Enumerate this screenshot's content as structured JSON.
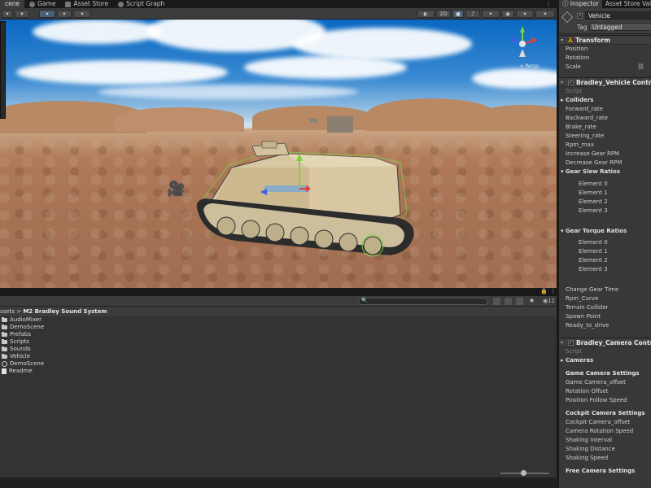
{
  "editor_tabs": [
    {
      "label": "cene",
      "active": true,
      "icon": "scene-icon"
    },
    {
      "label": "Game",
      "active": false,
      "icon": "game-icon"
    },
    {
      "label": "Asset Store",
      "active": false,
      "icon": "asset-store-icon"
    },
    {
      "label": "Script Graph",
      "active": false,
      "icon": "script-graph-icon"
    }
  ],
  "scene_toolbar": {
    "mode_2d": "2D"
  },
  "scene": {
    "gizmo_label": "< Persp"
  },
  "project": {
    "search_count": "11",
    "breadcrumb_root": "ssets",
    "breadcrumb_sep": " > ",
    "breadcrumb_current": "M2 Bradley Sound System",
    "items": [
      {
        "name": "AudioMixer",
        "type": "folder"
      },
      {
        "name": "DemoScene",
        "type": "folder"
      },
      {
        "name": "Prefabs",
        "type": "folder"
      },
      {
        "name": "Scripts",
        "type": "folder"
      },
      {
        "name": "Sounds",
        "type": "folder"
      },
      {
        "name": "Vehicle",
        "type": "folder"
      },
      {
        "name": "DemoScene",
        "type": "scene"
      },
      {
        "name": "Readme",
        "type": "document"
      }
    ]
  },
  "inspector": {
    "tabs": [
      {
        "label": "Inspector",
        "active": true
      },
      {
        "label": "Asset Store Validat",
        "active": false
      }
    ],
    "object_name": "Vehicle",
    "tag_label": "Tag",
    "tag_value": "Untagged",
    "transform": {
      "title": "Transform",
      "fields": [
        "Position",
        "Rotation",
        "Scale"
      ]
    },
    "vehicle_controller": {
      "title": "Bradley_Vehicle Controlle",
      "script_label": "Script",
      "colliders": "Colliders",
      "fields": [
        "Forward_rate",
        "Backward_rate",
        "Brake_rate",
        "Steering_rate",
        "Rpm_max",
        "Increase Gear RPM",
        "Decrease Gear RPM"
      ],
      "slew_title": "Gear Slew Ratios",
      "slew_elements": [
        "Element 0",
        "Element 1",
        "Element 2",
        "Element 3"
      ],
      "torque_title": "Gear Torque Ratios",
      "torque_elements": [
        "Element 0",
        "Element 1",
        "Element 2",
        "Element 3"
      ],
      "more_fields": [
        "Change Gear Time",
        "Rpm_Curve",
        "Terrain Collider",
        "Spawn Point",
        "Ready_to_drive"
      ]
    },
    "camera_controller": {
      "title": "Bradley_Camera Controlle",
      "script_label": "Script",
      "cameras": "Cameras",
      "game_title": "Game Camera Settings",
      "game_fields": [
        "Game Camera_offset",
        "Rotation Offset",
        "Position Follow Speed"
      ],
      "cockpit_title": "Cockpit Camera Settings",
      "cockpit_fields": [
        "Cockpit Camera_offset",
        "Camera Rotation Speed",
        "Shaking Interval",
        "Shaking Distance",
        "Shaking Speed"
      ],
      "free_title": "Free Camera Settings"
    }
  }
}
